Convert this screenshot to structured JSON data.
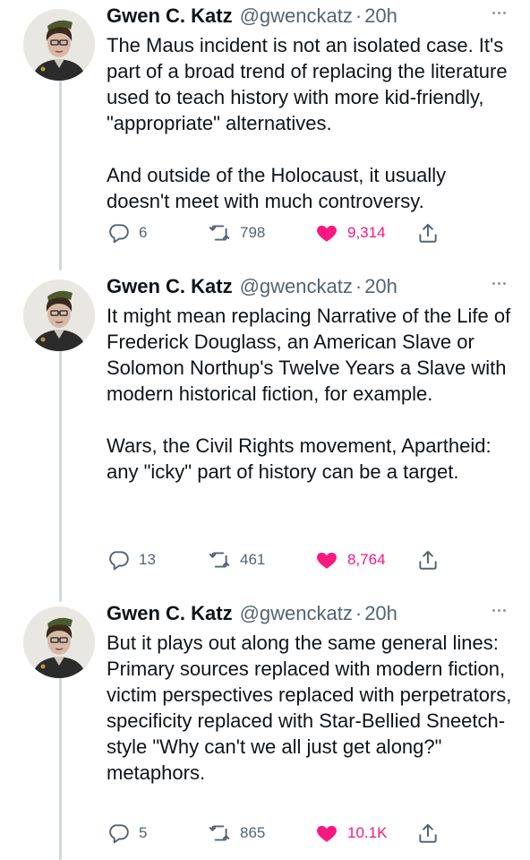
{
  "thread": {
    "tweets": [
      {
        "author_name": "Gwen C. Katz",
        "author_handle": "@gwenckatz",
        "separator": "·",
        "time": "20h",
        "paragraphs": [
          "The Maus incident is not an isolated case. It's part of a broad trend of replacing the literature used to teach history with more kid-friendly, \"appropriate\" alternatives.",
          "And outside of the Holocaust, it usually doesn't meet with much controversy."
        ],
        "replies": "6",
        "retweets": "798",
        "likes": "9,314"
      },
      {
        "author_name": "Gwen C. Katz",
        "author_handle": "@gwenckatz",
        "separator": "·",
        "time": "20h",
        "paragraphs": [
          "It might mean replacing Narrative of the Life of Frederick Douglass, an American Slave or Solomon Northup's Twelve Years a Slave with modern historical fiction, for example.",
          "Wars, the Civil Rights movement, Apartheid: any \"icky\" part of history can be a target."
        ],
        "replies": "13",
        "retweets": "461",
        "likes": "8,764"
      },
      {
        "author_name": "Gwen C. Katz",
        "author_handle": "@gwenckatz",
        "separator": "·",
        "time": "20h",
        "paragraphs": [
          "But it plays out along the same general lines: Primary sources replaced with modern fiction, victim perspectives replaced with perpetrators, specificity replaced with Star-Bellied Sneetch-style \"Why can't we all just get along?\" metaphors."
        ],
        "replies": "5",
        "retweets": "865",
        "likes": "10.1K"
      }
    ]
  },
  "icons": {
    "reply": "reply-icon",
    "retweet": "retweet-icon",
    "like": "heart-icon",
    "share": "share-icon",
    "more": "more-icon"
  },
  "colors": {
    "text": "#0f1419",
    "muted": "#536471",
    "like": "#f91880",
    "thread_line": "#cfd9de"
  }
}
